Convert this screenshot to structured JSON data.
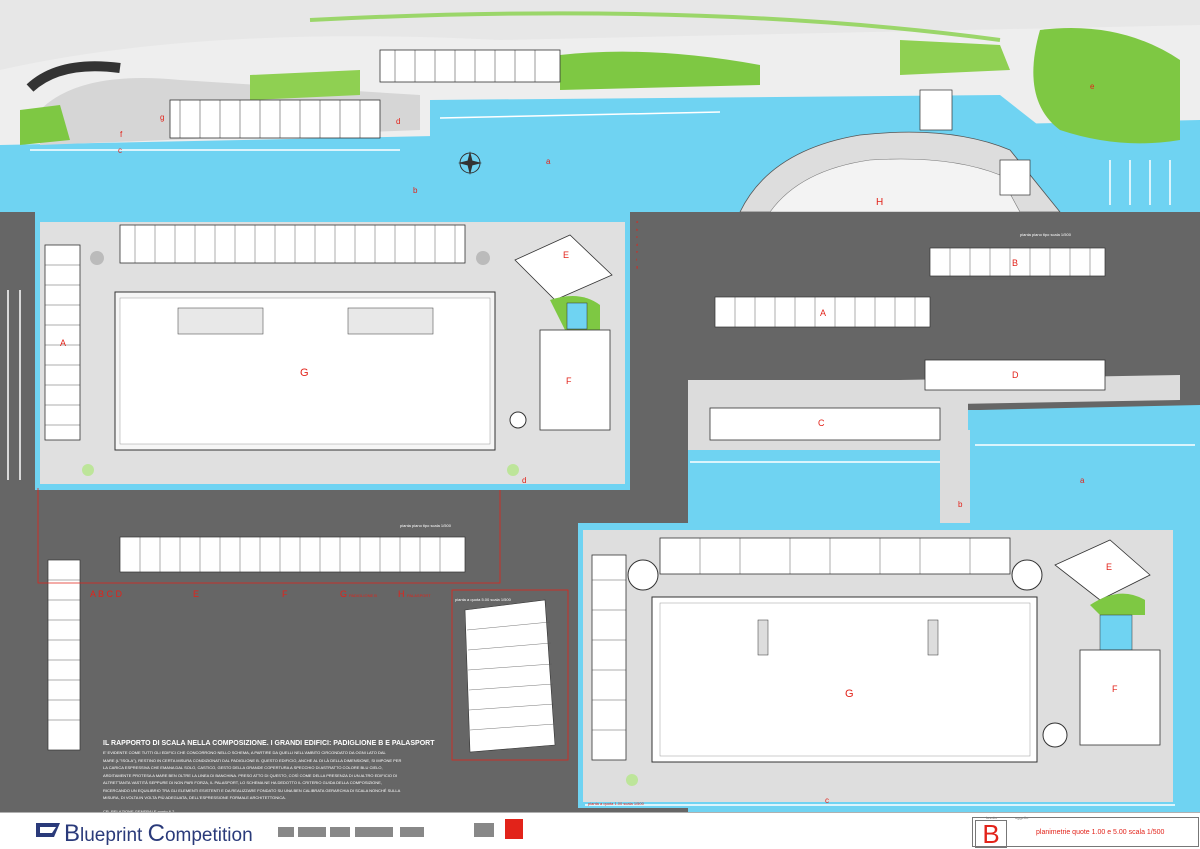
{
  "colors": {
    "water": "#6fd3f2",
    "paving": "#dbdbdb",
    "board": "#666666",
    "green": "#7ec843",
    "accent": "#e2231a",
    "magenta": "#e83c8c",
    "logo": "#2a3a7a"
  },
  "top_plan": {
    "labels": {
      "a": "a",
      "b": "b",
      "c": "c",
      "d": "d",
      "e": "e",
      "f": "f",
      "g": "g",
      "H": "H"
    }
  },
  "plan_left": {
    "A": "A",
    "E": "E",
    "F": "F",
    "G": "G"
  },
  "plan_right": {
    "scale_caption": "pianta piano tipo scala 1/500",
    "A": "A",
    "B": "B",
    "C": "C",
    "D": "D"
  },
  "plan_bottom_right": {
    "E": "E",
    "F": "F",
    "G": "G",
    "a": "a",
    "b": "b",
    "c": "c",
    "d": "d",
    "caption": "pianta a quota 1.00 scala 1/500"
  },
  "mid_caption": "pianta piano tipo scala 1/500",
  "small_plan_caption": "pianta a quota 5.00 scala 1/500",
  "legend_top": {
    "items": [
      "a",
      "b",
      "c",
      "d",
      "e",
      "f",
      "g"
    ]
  },
  "legend_groups": {
    "abcd": "A B C D",
    "e": "E",
    "f": "F",
    "g": "G",
    "h": "H",
    "g_sub": "PADIGLIONE B",
    "h_sub": "PALASPORT"
  },
  "text_block": {
    "title": "IL RAPPORTO DI SCALA NELLA COMPOSIZIONE. I GRANDI EDIFICI: PADIGLIONE B E PALASPORT",
    "lines": [
      "E' EVIDENTE COME TUTTI GLI EDIFICI CHE CONCORRONO NELLO SCHEMA, A PARTIRE DA QUELLI NELL'AMBITO CIRCONDATO DA OGNI LATO DAL",
      "MARE (L'\"ISOLA\"), RESTINO IN CERTA MISURA CONDIZIONATI DAL PADIGLIONE B. QUESTO EDIFICIO, ANCHE AL DI LÀ DELLA DIMENSIONE, SI IMPONE PER",
      "LA CARICA ESPRESSIVA CHE EMANA DAL SOLO, CASTICO, GESTO DELLA GRANDE COPERTURA A SPECCHIO DI ASTRATTO COLORE BLU CIELO,",
      "ARDITAMENTE PROTESA A MARE BEN OLTRE LA LINEA DI BANCHINA. PRESO ATTO DI QUESTO, COSÌ COME DELLA PRESENZA DI UN ALTRO EDIFICIO DI",
      "ALTRETTANTA VASTITÀ SEPPURE DI NON PARI FORZA, IL PALASPORT, LO SCHEMA NE HA DEDOTTO IL CRITERIO GUIDA DELLA COMPOSIZIONE,",
      "RICERCANDO UN EQUILIBRIO TRA GLI ELEMENTI ESISTENTI E DA REALIZZARE FONDATO SU UNA BEN CALIBRATA GERARCHIA DI SCALA NONCHÉ SULLA",
      "MISURA, DI VOLTA IN VOLTA PIÙ ADEGUATA, DELL'ESPRESSIONE FORMALE ARCHITETTONICA."
    ],
    "ref": "CR. RELAZIONE GENERALE punto 6.2"
  },
  "footer": {
    "logo_first": "B",
    "logo_mid": "lueprint ",
    "logo_c": "C",
    "logo_rest": "ompetition",
    "tavola_label": "tavola",
    "tavola_letter": "B",
    "oggetto_label": "oggetto",
    "subject": "planimetrie quote 1.00 e 5.00 scala 1/500"
  }
}
